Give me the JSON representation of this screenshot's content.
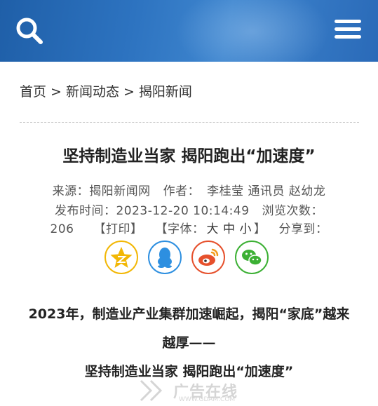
{
  "header": {
    "search_icon": "search-icon",
    "menu_icon": "hamburger-menu-icon"
  },
  "breadcrumb": {
    "home": "首页",
    "separator": ">",
    "news": "新闻动态",
    "current": "揭阳新闻"
  },
  "article": {
    "title": "坚持制造业当家 揭阳跑出“加速度”",
    "source_label": "来源：",
    "source": "揭阳新闻网",
    "author_label": "作者：",
    "author": "李桂莹 通讯员 赵幼龙",
    "published_label": "发布时间：",
    "published": "2023-12-20 10:14:49",
    "views_label": "浏览次数：",
    "views": "206",
    "print": "【打印】",
    "font_label": "【字体：",
    "font_large": "大",
    "font_medium": "中",
    "font_small": "小",
    "font_close": "】",
    "share_label": "分享到："
  },
  "share": [
    {
      "name": "qzone",
      "color": "#f2b705"
    },
    {
      "name": "qq",
      "color": "#2d8fe0"
    },
    {
      "name": "weibo",
      "color": "#e6502c"
    },
    {
      "name": "wechat",
      "color": "#3cb034"
    }
  ],
  "body": {
    "line1": "2023年，制造业产业集群加速崛起，揭阳“家底”越来",
    "line2": "越厚——",
    "line3": "坚持制造业当家 揭阳跑出“加速度”"
  },
  "watermark": {
    "text": "广告在线",
    "url": "WWW.GDAM.COM"
  }
}
